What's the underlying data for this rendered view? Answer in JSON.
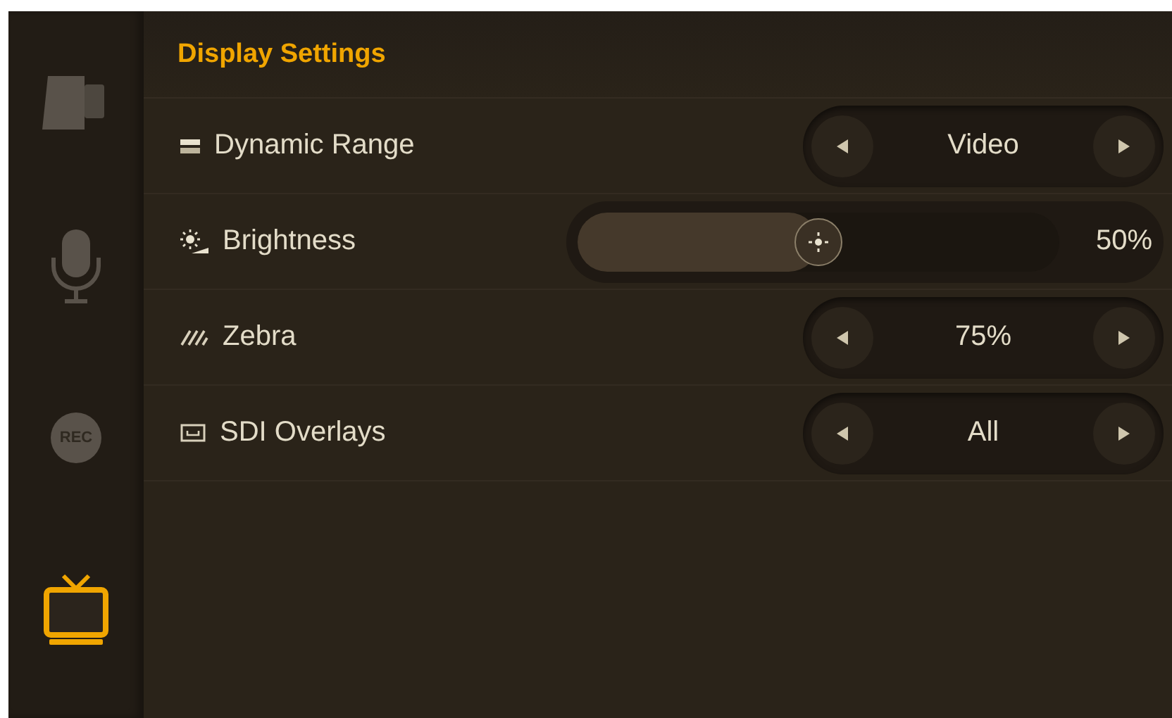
{
  "sidebar": {
    "items": [
      {
        "kind": "camera",
        "selected": false
      },
      {
        "kind": "microphone",
        "selected": false
      },
      {
        "kind": "record",
        "label": "REC",
        "selected": false
      },
      {
        "kind": "monitor",
        "selected": true
      }
    ]
  },
  "title": "Display Settings",
  "settings": [
    {
      "kind": "selector",
      "label": "Dynamic Range",
      "value": "Video"
    },
    {
      "kind": "slider",
      "label": "Brightness",
      "level": 0.5,
      "reading": "50%"
    },
    {
      "kind": "selector",
      "label": "Zebra",
      "value": "75%"
    },
    {
      "kind": "selector",
      "label": "SDI Overlays",
      "value": "All"
    }
  ]
}
